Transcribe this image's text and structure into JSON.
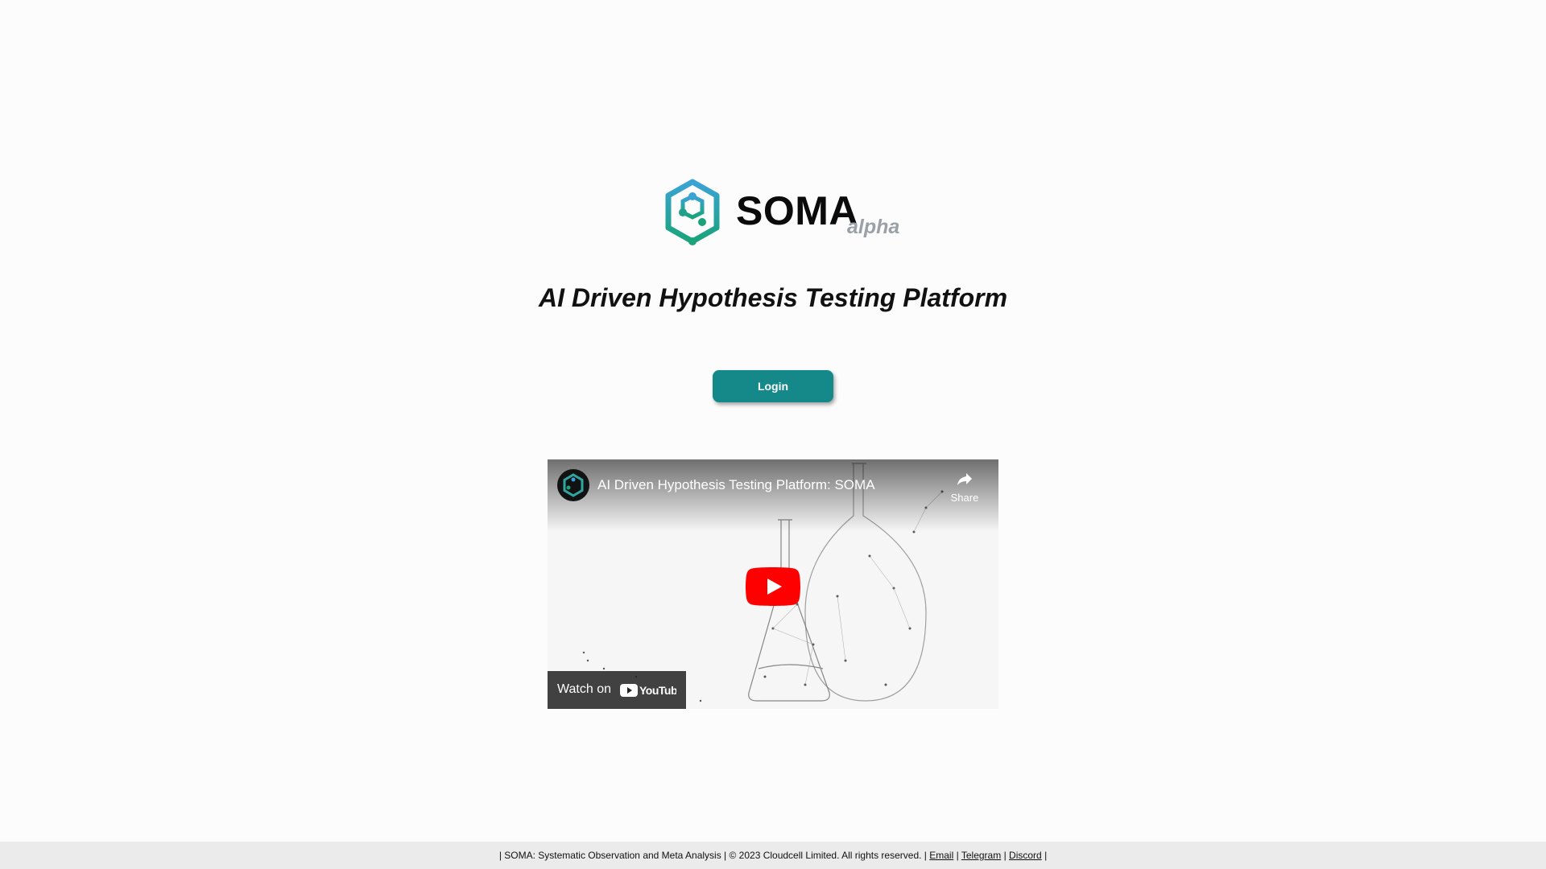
{
  "logo": {
    "text": "SOMA",
    "sub": "alpha",
    "icon": "soma-hexagon-icon",
    "colors": {
      "gradient_start": "#3aa3d6",
      "gradient_end": "#1aa37a"
    }
  },
  "tagline": "AI Driven Hypothesis Testing Platform",
  "login": {
    "label": "Login",
    "color": "#15888a"
  },
  "video": {
    "title": "AI Driven Hypothesis Testing Platform: SOMA",
    "share_label": "Share",
    "watch_on_label": "Watch on",
    "platform_logo": "YouTube",
    "play_icon": "play-icon"
  },
  "footer": {
    "prefix": "| SOMA: Systematic Observation and Meta Analysis | © 2023 Cloudcell Limited. All rights reserved. |",
    "email_label": "Email",
    "sep1": "|",
    "telegram_label": "Telegram",
    "sep2": "|",
    "discord_label": "Discord",
    "suffix": "|"
  }
}
